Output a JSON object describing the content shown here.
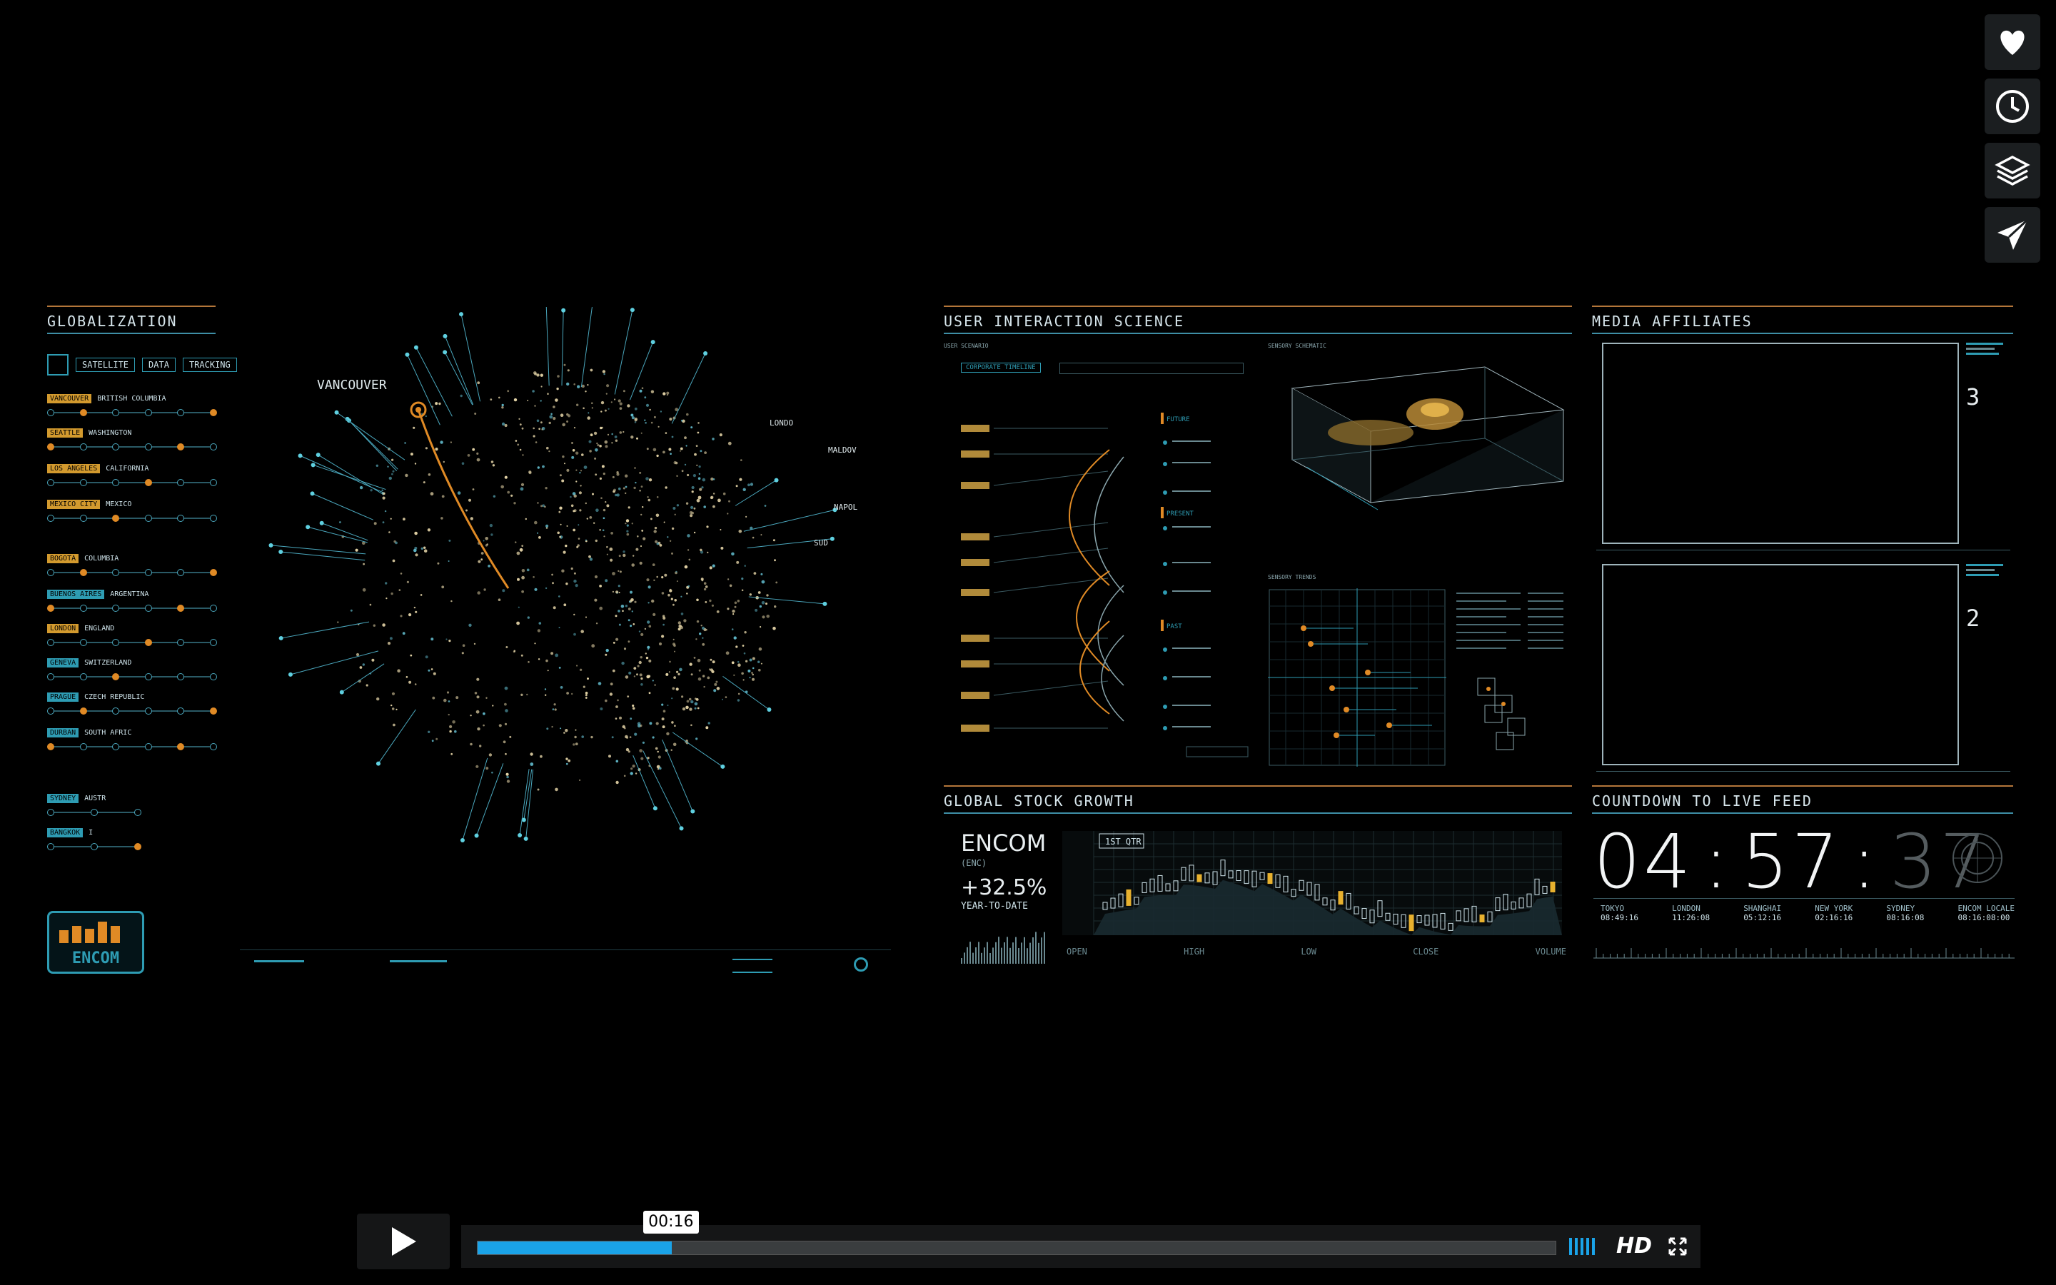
{
  "sidebar_actions": [
    {
      "icon": "heart-icon"
    },
    {
      "icon": "clock-icon"
    },
    {
      "icon": "layers-icon"
    },
    {
      "icon": "send-icon"
    }
  ],
  "globalization": {
    "title": "GLOBALIZATION",
    "tabs": [
      "SATELLITE",
      "DATA",
      "TRACKING"
    ],
    "locations": [
      {
        "tag": "VANCOUVER",
        "region": "BRITISH COLUMBIA"
      },
      {
        "tag": "SEATTLE",
        "region": "WASHINGTON"
      },
      {
        "tag": "LOS ANGELES",
        "region": "CALIFORNIA"
      },
      {
        "tag": "MEXICO CITY",
        "region": "MEXICO"
      },
      {
        "tag": "BOGOTA",
        "region": "COLUMBIA"
      },
      {
        "tag": "BUENOS AIRES",
        "region": "ARGENTINA"
      },
      {
        "tag": "LONDON",
        "region": "ENGLAND"
      },
      {
        "tag": "GENEVA",
        "region": "SWITZERLAND"
      },
      {
        "tag": "PRAGUE",
        "region": "CZECH REPUBLIC"
      },
      {
        "tag": "DURBAN",
        "region": "SOUTH AFRIC"
      },
      {
        "tag": "SYDNEY",
        "region": "AUSTR"
      },
      {
        "tag": "BANGKOK",
        "region": "I"
      }
    ],
    "logo_text": "ENCOM"
  },
  "globe": {
    "labels": [
      "VANCOUVER",
      "LONDO",
      "MALDOV",
      "NAPOL",
      "SUD"
    ]
  },
  "user_interaction": {
    "title": "USER INTERACTION SCIENCE",
    "sublabel_left": "USER SCENARIO",
    "sublabel_right": "SENSORY SCHEMATIC",
    "timeline_label": "CORPORATE TIMELINE",
    "phases": [
      "FUTURE",
      "PRESENT",
      "PAST"
    ],
    "sensory_label": "SENSORY TRENDS"
  },
  "media": {
    "title": "MEDIA AFFILIATES",
    "channel_a": "3",
    "channel_b": "2"
  },
  "stock": {
    "title": "GLOBAL STOCK GROWTH",
    "company": "ENCOM",
    "ticker": "(ENC)",
    "change": "+32.5%",
    "change_label": "YEAR-TO-DATE",
    "quarter": "1ST QTR",
    "footer": [
      "OPEN",
      "HIGH",
      "LOW",
      "CLOSE",
      "VOLUME"
    ]
  },
  "countdown": {
    "title": "COUNTDOWN TO LIVE FEED",
    "h": "04",
    "m": "57",
    "s": "37",
    "cities": [
      {
        "name": "TOKYO",
        "time": "08:49:16"
      },
      {
        "name": "LONDON",
        "time": "11:26:08"
      },
      {
        "name": "SHANGHAI",
        "time": "05:12:16"
      },
      {
        "name": "NEW YORK",
        "time": "02:16:16"
      },
      {
        "name": "SYDNEY",
        "time": "08:16:08"
      },
      {
        "name": "ENCOM LOCALE",
        "time": "08:16:08:00"
      }
    ]
  },
  "player": {
    "time": "00:16",
    "progress": 0.18,
    "hd_label": "HD"
  }
}
